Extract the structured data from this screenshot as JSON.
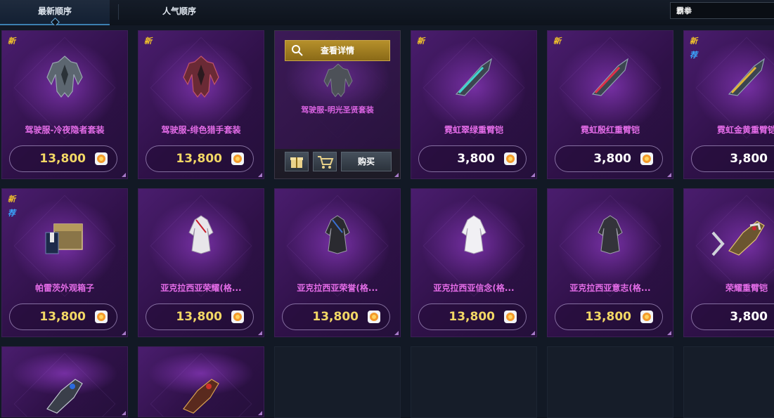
{
  "tabs": [
    {
      "label": "最新顺序",
      "active": true
    },
    {
      "label": "人气顺序",
      "active": false
    }
  ],
  "search": {
    "value": "霸拳"
  },
  "badges": {
    "new": "新",
    "recommend": "荐"
  },
  "hover_card": {
    "detail_label": "查看详情",
    "name": "驾驶服-明光圣贤套装",
    "buy_label": "购买"
  },
  "items": [
    {
      "name": "驾驶服-冷夜隐者套装",
      "price": "13,800",
      "currency": "gold",
      "new": true,
      "recommend": false,
      "icon": "armor-suit-dark-icon"
    },
    {
      "name": "驾驶服-绯色猎手套装",
      "price": "13,800",
      "currency": "gold",
      "new": true,
      "recommend": false,
      "icon": "armor-suit-red-icon"
    },
    {
      "name": "霓虹翠绿重臂铠",
      "price": "3,800",
      "currency": "white",
      "new": true,
      "recommend": false,
      "icon": "heavy-arm-green-icon"
    },
    {
      "name": "霓虹殷红重臂铠",
      "price": "3,800",
      "currency": "white",
      "new": true,
      "recommend": false,
      "icon": "heavy-arm-red-icon"
    },
    {
      "name": "霓虹金黄重臂铠",
      "price": "3,800",
      "currency": "white",
      "new": true,
      "recommend": true,
      "icon": "heavy-arm-gold-icon"
    },
    {
      "name": "帕雷茨外观箱子",
      "price": "13,800",
      "currency": "gold",
      "new": true,
      "recommend": true,
      "icon": "appearance-chest-icon"
    },
    {
      "name": "亚克拉西亚荣耀(格...",
      "price": "13,800",
      "currency": "gold",
      "new": false,
      "recommend": false,
      "icon": "outfit-white-icon"
    },
    {
      "name": "亚克拉西亚荣誉(格...",
      "price": "13,800",
      "currency": "gold",
      "new": false,
      "recommend": false,
      "icon": "outfit-black-icon"
    },
    {
      "name": "亚克拉西亚信念(格...",
      "price": "13,800",
      "currency": "gold",
      "new": false,
      "recommend": false,
      "icon": "outfit-white-icon"
    },
    {
      "name": "亚克拉西亚意志(格...",
      "price": "13,800",
      "currency": "gold",
      "new": false,
      "recommend": false,
      "icon": "outfit-black-icon"
    },
    {
      "name": "荣耀重臂铠",
      "price": "3,800",
      "currency": "white",
      "new": false,
      "recommend": false,
      "icon": "gauntlet-icon"
    }
  ],
  "partial_items": [
    {
      "icon": "gauntlet-blue-icon"
    },
    {
      "icon": "gauntlet-red-icon"
    }
  ],
  "colors": {
    "item_name": "#e46ce8",
    "price_gold": "#f2d765",
    "badge_new": "#f3c52a",
    "badge_recommend": "#39a8ff"
  }
}
